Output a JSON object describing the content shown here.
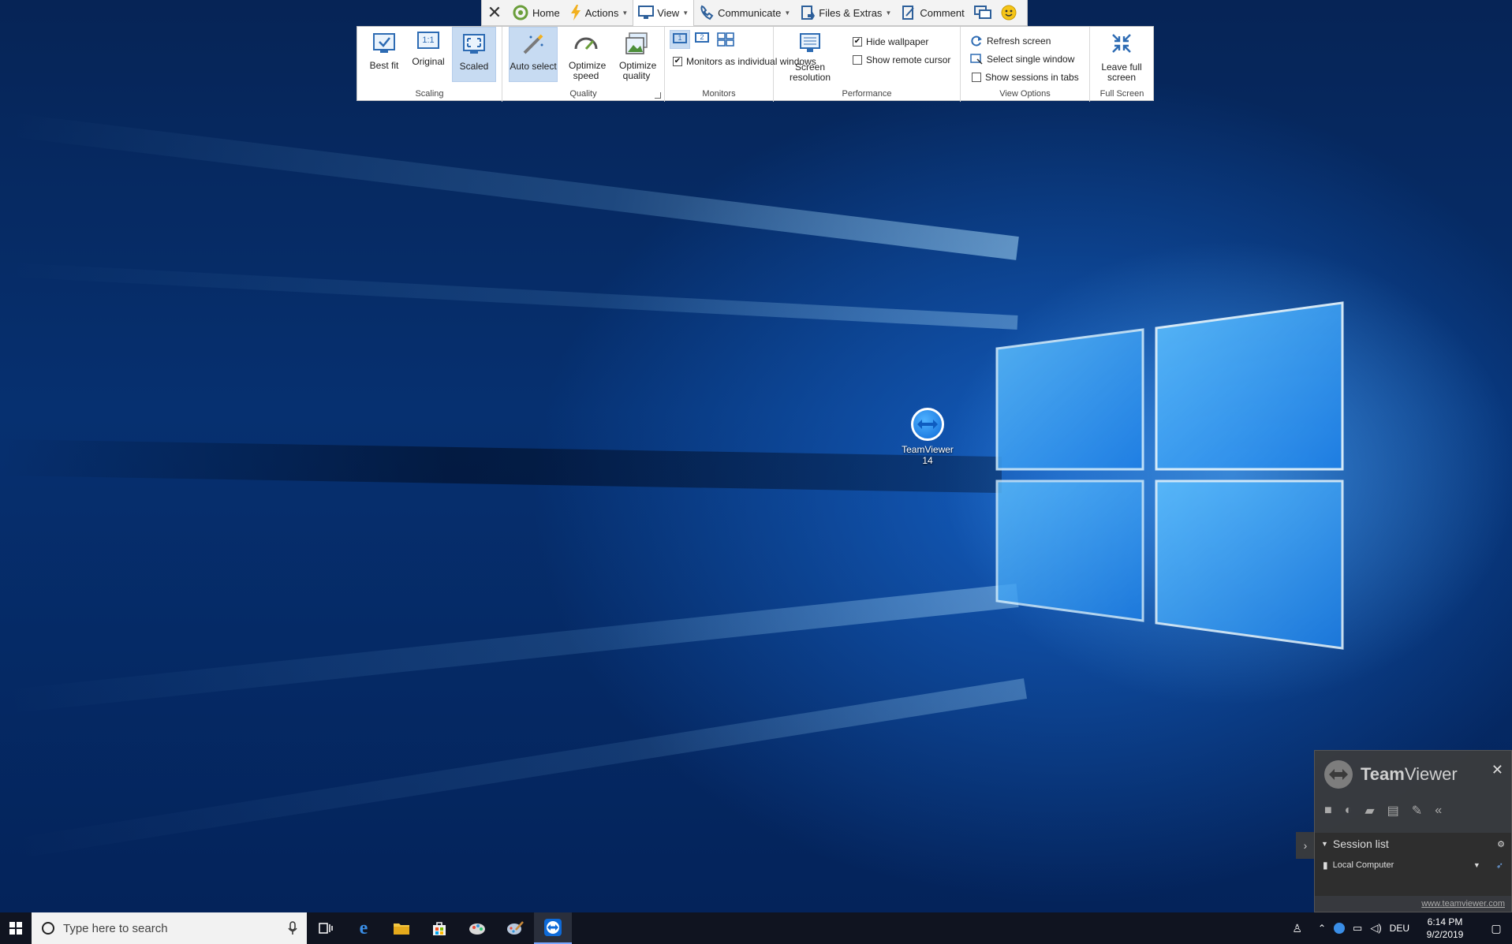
{
  "tabbar": {
    "close_label": "✕",
    "tabs": [
      {
        "label": "Home"
      },
      {
        "label": "Actions"
      },
      {
        "label": "View"
      },
      {
        "label": "Communicate"
      },
      {
        "label": "Files & Extras"
      },
      {
        "label": "Comment"
      }
    ]
  },
  "ribbon": {
    "scaling": {
      "label": "Scaling",
      "best_fit": "Best fit",
      "original": "Original",
      "original_icon_text": "1:1",
      "scaled": "Scaled"
    },
    "quality": {
      "label": "Quality",
      "auto_select": "Auto select",
      "optimize_speed": "Optimize speed",
      "optimize_quality": "Optimize quality"
    },
    "monitors": {
      "label": "Monitors",
      "m1": "1",
      "m2": "2",
      "monitors_as_windows": "Monitors as individual windows",
      "monitors_as_windows_checked": true
    },
    "performance": {
      "label": "Performance",
      "screen_resolution": "Screen resolution",
      "hide_wallpaper": "Hide wallpaper",
      "hide_wallpaper_checked": true,
      "show_remote_cursor": "Show remote cursor",
      "show_remote_cursor_checked": false
    },
    "view_options": {
      "label": "View Options",
      "refresh_screen": "Refresh screen",
      "select_single_window": "Select single window",
      "show_sessions_in_tabs": "Show sessions in tabs",
      "show_sessions_in_tabs_checked": false
    },
    "full_screen": {
      "label": "Full Screen",
      "leave_full_screen": "Leave full screen"
    }
  },
  "desktop": {
    "icon_label_line1": "TeamViewer",
    "icon_label_line2": "14"
  },
  "taskbar": {
    "search_placeholder": "Type here to search",
    "language": "DEU",
    "time": "6:14 PM",
    "date": "9/2/2019"
  },
  "tvpanel": {
    "title_bold": "Team",
    "title_rest": "Viewer",
    "session_list": "Session list",
    "local_computer": "Local Computer",
    "link": "www.teamviewer.com"
  },
  "colors": {
    "accent": "#1a6fd0",
    "ribbon_selected": "#c7dbf2",
    "taskbar": "#101420"
  }
}
